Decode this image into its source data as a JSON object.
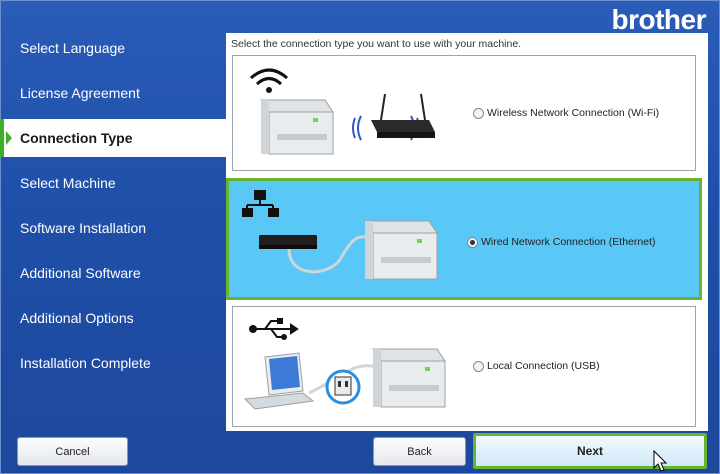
{
  "brand": {
    "logo_text": "brother"
  },
  "steps": [
    {
      "label": "Select Language",
      "active": false
    },
    {
      "label": "License Agreement",
      "active": false
    },
    {
      "label": "Connection Type",
      "active": true
    },
    {
      "label": "Select Machine",
      "active": false
    },
    {
      "label": "Software Installation",
      "active": false
    },
    {
      "label": "Additional Software",
      "active": false
    },
    {
      "label": "Additional Options",
      "active": false
    },
    {
      "label": "Installation Complete",
      "active": false
    }
  ],
  "content": {
    "instruction": "Select the connection type you want to use with your machine.",
    "options": [
      {
        "label": "Wireless Network Connection (Wi-Fi)",
        "selected": false
      },
      {
        "label": "Wired Network Connection (Ethernet)",
        "selected": true
      },
      {
        "label": "Local Connection (USB)",
        "selected": false
      }
    ]
  },
  "buttons": {
    "cancel": "Cancel",
    "back": "Back",
    "next": "Next"
  },
  "colors": {
    "background": "#1f4fa8",
    "selected_option": "#5ac8f6",
    "highlight_border": "#67b431"
  }
}
